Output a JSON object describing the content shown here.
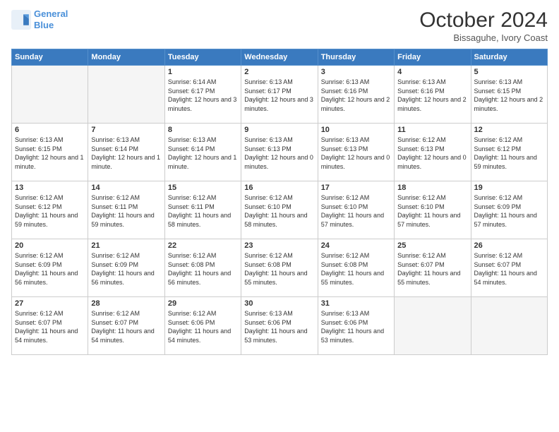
{
  "logo": {
    "line1": "General",
    "line2": "Blue"
  },
  "title": "October 2024",
  "subtitle": "Bissaguhe, Ivory Coast",
  "weekdays": [
    "Sunday",
    "Monday",
    "Tuesday",
    "Wednesday",
    "Thursday",
    "Friday",
    "Saturday"
  ],
  "weeks": [
    [
      {
        "day": "",
        "info": ""
      },
      {
        "day": "",
        "info": ""
      },
      {
        "day": "1",
        "info": "Sunrise: 6:14 AM\nSunset: 6:17 PM\nDaylight: 12 hours and 3 minutes."
      },
      {
        "day": "2",
        "info": "Sunrise: 6:13 AM\nSunset: 6:17 PM\nDaylight: 12 hours and 3 minutes."
      },
      {
        "day": "3",
        "info": "Sunrise: 6:13 AM\nSunset: 6:16 PM\nDaylight: 12 hours and 2 minutes."
      },
      {
        "day": "4",
        "info": "Sunrise: 6:13 AM\nSunset: 6:16 PM\nDaylight: 12 hours and 2 minutes."
      },
      {
        "day": "5",
        "info": "Sunrise: 6:13 AM\nSunset: 6:15 PM\nDaylight: 12 hours and 2 minutes."
      }
    ],
    [
      {
        "day": "6",
        "info": "Sunrise: 6:13 AM\nSunset: 6:15 PM\nDaylight: 12 hours and 1 minute."
      },
      {
        "day": "7",
        "info": "Sunrise: 6:13 AM\nSunset: 6:14 PM\nDaylight: 12 hours and 1 minute."
      },
      {
        "day": "8",
        "info": "Sunrise: 6:13 AM\nSunset: 6:14 PM\nDaylight: 12 hours and 1 minute."
      },
      {
        "day": "9",
        "info": "Sunrise: 6:13 AM\nSunset: 6:13 PM\nDaylight: 12 hours and 0 minutes."
      },
      {
        "day": "10",
        "info": "Sunrise: 6:13 AM\nSunset: 6:13 PM\nDaylight: 12 hours and 0 minutes."
      },
      {
        "day": "11",
        "info": "Sunrise: 6:12 AM\nSunset: 6:13 PM\nDaylight: 12 hours and 0 minutes."
      },
      {
        "day": "12",
        "info": "Sunrise: 6:12 AM\nSunset: 6:12 PM\nDaylight: 11 hours and 59 minutes."
      }
    ],
    [
      {
        "day": "13",
        "info": "Sunrise: 6:12 AM\nSunset: 6:12 PM\nDaylight: 11 hours and 59 minutes."
      },
      {
        "day": "14",
        "info": "Sunrise: 6:12 AM\nSunset: 6:11 PM\nDaylight: 11 hours and 59 minutes."
      },
      {
        "day": "15",
        "info": "Sunrise: 6:12 AM\nSunset: 6:11 PM\nDaylight: 11 hours and 58 minutes."
      },
      {
        "day": "16",
        "info": "Sunrise: 6:12 AM\nSunset: 6:10 PM\nDaylight: 11 hours and 58 minutes."
      },
      {
        "day": "17",
        "info": "Sunrise: 6:12 AM\nSunset: 6:10 PM\nDaylight: 11 hours and 57 minutes."
      },
      {
        "day": "18",
        "info": "Sunrise: 6:12 AM\nSunset: 6:10 PM\nDaylight: 11 hours and 57 minutes."
      },
      {
        "day": "19",
        "info": "Sunrise: 6:12 AM\nSunset: 6:09 PM\nDaylight: 11 hours and 57 minutes."
      }
    ],
    [
      {
        "day": "20",
        "info": "Sunrise: 6:12 AM\nSunset: 6:09 PM\nDaylight: 11 hours and 56 minutes."
      },
      {
        "day": "21",
        "info": "Sunrise: 6:12 AM\nSunset: 6:09 PM\nDaylight: 11 hours and 56 minutes."
      },
      {
        "day": "22",
        "info": "Sunrise: 6:12 AM\nSunset: 6:08 PM\nDaylight: 11 hours and 56 minutes."
      },
      {
        "day": "23",
        "info": "Sunrise: 6:12 AM\nSunset: 6:08 PM\nDaylight: 11 hours and 55 minutes."
      },
      {
        "day": "24",
        "info": "Sunrise: 6:12 AM\nSunset: 6:08 PM\nDaylight: 11 hours and 55 minutes."
      },
      {
        "day": "25",
        "info": "Sunrise: 6:12 AM\nSunset: 6:07 PM\nDaylight: 11 hours and 55 minutes."
      },
      {
        "day": "26",
        "info": "Sunrise: 6:12 AM\nSunset: 6:07 PM\nDaylight: 11 hours and 54 minutes."
      }
    ],
    [
      {
        "day": "27",
        "info": "Sunrise: 6:12 AM\nSunset: 6:07 PM\nDaylight: 11 hours and 54 minutes."
      },
      {
        "day": "28",
        "info": "Sunrise: 6:12 AM\nSunset: 6:07 PM\nDaylight: 11 hours and 54 minutes."
      },
      {
        "day": "29",
        "info": "Sunrise: 6:12 AM\nSunset: 6:06 PM\nDaylight: 11 hours and 54 minutes."
      },
      {
        "day": "30",
        "info": "Sunrise: 6:13 AM\nSunset: 6:06 PM\nDaylight: 11 hours and 53 minutes."
      },
      {
        "day": "31",
        "info": "Sunrise: 6:13 AM\nSunset: 6:06 PM\nDaylight: 11 hours and 53 minutes."
      },
      {
        "day": "",
        "info": ""
      },
      {
        "day": "",
        "info": ""
      }
    ]
  ]
}
